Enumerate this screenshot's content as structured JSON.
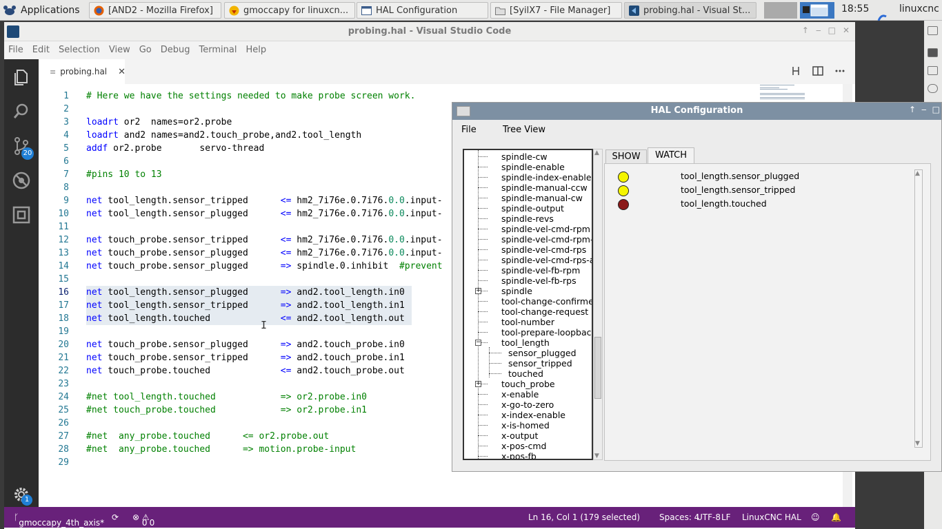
{
  "taskbar": {
    "applications": "Applications",
    "tasks": [
      {
        "label": "[AND2 - Mozilla Firefox]",
        "icon": "firefox-icon"
      },
      {
        "label": "gmoccapy for linuxcn...",
        "icon": "gmoccapy-icon"
      },
      {
        "label": "HAL Configuration",
        "icon": "window-icon"
      },
      {
        "label": "[SyilX7 - File Manager]",
        "icon": "folder-icon"
      },
      {
        "label": "probing.hal - Visual St...",
        "icon": "vscode-icon"
      }
    ],
    "clock": "18:55",
    "user": "linuxcnc"
  },
  "vscode": {
    "title": "probing.hal - Visual Studio Code",
    "menu": [
      "File",
      "Edit",
      "Selection",
      "View",
      "Go",
      "Debug",
      "Terminal",
      "Help"
    ],
    "tab": "probing.hal",
    "scm_badge": "20",
    "settings_badge": "1",
    "lines": [
      {
        "n": "1",
        "segs": [
          {
            "t": "# Here we have the settings needed to make probe screen work.",
            "c": "cm"
          }
        ]
      },
      {
        "n": "2",
        "segs": []
      },
      {
        "n": "3",
        "segs": [
          {
            "t": "loadrt",
            "c": "kw"
          },
          {
            "t": " or2  names=or2.probe",
            "c": ""
          }
        ]
      },
      {
        "n": "4",
        "segs": [
          {
            "t": "loadrt",
            "c": "kw"
          },
          {
            "t": " and2 names=and2.touch_probe,and2.tool_length",
            "c": ""
          }
        ]
      },
      {
        "n": "5",
        "segs": [
          {
            "t": "addf",
            "c": "kw"
          },
          {
            "t": " or2.probe       servo-thread",
            "c": ""
          }
        ]
      },
      {
        "n": "6",
        "segs": []
      },
      {
        "n": "7",
        "segs": [
          {
            "t": "#pins 10 to 13",
            "c": "cm"
          }
        ]
      },
      {
        "n": "8",
        "segs": []
      },
      {
        "n": "9",
        "segs": [
          {
            "t": "net",
            "c": "kw"
          },
          {
            "t": " tool_length.sensor_tripped      ",
            "c": ""
          },
          {
            "t": "<=",
            "c": "kw"
          },
          {
            "t": " hm2_7i76e.0.7i76.",
            "c": ""
          },
          {
            "t": "0.0",
            "c": "num"
          },
          {
            "t": ".input-",
            "c": ""
          }
        ]
      },
      {
        "n": "10",
        "segs": [
          {
            "t": "net",
            "c": "kw"
          },
          {
            "t": " tool_length.sensor_plugged      ",
            "c": ""
          },
          {
            "t": "<=",
            "c": "kw"
          },
          {
            "t": " hm2_7i76e.0.7i76.",
            "c": ""
          },
          {
            "t": "0.0",
            "c": "num"
          },
          {
            "t": ".input-",
            "c": ""
          }
        ]
      },
      {
        "n": "11",
        "segs": []
      },
      {
        "n": "12",
        "segs": [
          {
            "t": "net",
            "c": "kw"
          },
          {
            "t": " touch_probe.sensor_tripped      ",
            "c": ""
          },
          {
            "t": "<=",
            "c": "kw"
          },
          {
            "t": " hm2_7i76e.0.7i76.",
            "c": ""
          },
          {
            "t": "0.0",
            "c": "num"
          },
          {
            "t": ".input-",
            "c": ""
          }
        ]
      },
      {
        "n": "13",
        "segs": [
          {
            "t": "net",
            "c": "kw"
          },
          {
            "t": " touch_probe.sensor_plugged      ",
            "c": ""
          },
          {
            "t": "<=",
            "c": "kw"
          },
          {
            "t": " hm2_7i76e.0.7i76.",
            "c": ""
          },
          {
            "t": "0.0",
            "c": "num"
          },
          {
            "t": ".input-",
            "c": ""
          }
        ]
      },
      {
        "n": "14",
        "segs": [
          {
            "t": "net",
            "c": "kw"
          },
          {
            "t": " touch_probe.sensor_plugged      ",
            "c": ""
          },
          {
            "t": "=>",
            "c": "kw"
          },
          {
            "t": " spindle.0.inhibit  ",
            "c": ""
          },
          {
            "t": "#prevent",
            "c": "cm"
          }
        ]
      },
      {
        "n": "15",
        "segs": []
      },
      {
        "n": "16",
        "segs": [
          {
            "t": "net",
            "c": "kw"
          },
          {
            "t": " tool_length.sensor_plugged      ",
            "c": ""
          },
          {
            "t": "=>",
            "c": "kw"
          },
          {
            "t": " and2.tool_length.in0",
            "c": ""
          }
        ]
      },
      {
        "n": "17",
        "segs": [
          {
            "t": "net",
            "c": "kw"
          },
          {
            "t": " tool_length.sensor_tripped      ",
            "c": ""
          },
          {
            "t": "=>",
            "c": "kw"
          },
          {
            "t": " and2.tool_length.in1",
            "c": ""
          }
        ]
      },
      {
        "n": "18",
        "segs": [
          {
            "t": "net",
            "c": "kw"
          },
          {
            "t": " tool_length.touched             ",
            "c": ""
          },
          {
            "t": "<=",
            "c": "kw"
          },
          {
            "t": " and2.tool_length.out",
            "c": ""
          }
        ]
      },
      {
        "n": "19",
        "segs": []
      },
      {
        "n": "20",
        "segs": [
          {
            "t": "net",
            "c": "kw"
          },
          {
            "t": " touch_probe.sensor_plugged      ",
            "c": ""
          },
          {
            "t": "=>",
            "c": "kw"
          },
          {
            "t": " and2.touch_probe.in0",
            "c": ""
          }
        ]
      },
      {
        "n": "21",
        "segs": [
          {
            "t": "net",
            "c": "kw"
          },
          {
            "t": " touch_probe.sensor_tripped      ",
            "c": ""
          },
          {
            "t": "=>",
            "c": "kw"
          },
          {
            "t": " and2.touch_probe.in1",
            "c": ""
          }
        ]
      },
      {
        "n": "22",
        "segs": [
          {
            "t": "net",
            "c": "kw"
          },
          {
            "t": " touch_probe.touched             ",
            "c": ""
          },
          {
            "t": "<=",
            "c": "kw"
          },
          {
            "t": " and2.touch_probe.out",
            "c": ""
          }
        ]
      },
      {
        "n": "23",
        "segs": []
      },
      {
        "n": "24",
        "segs": [
          {
            "t": "#net tool_length.touched            => or2.probe.in0",
            "c": "cm"
          }
        ]
      },
      {
        "n": "25",
        "segs": [
          {
            "t": "#net touch_probe.touched            => or2.probe.in1",
            "c": "cm"
          }
        ]
      },
      {
        "n": "26",
        "segs": []
      },
      {
        "n": "27",
        "segs": [
          {
            "t": "#net  any_probe.touched      <= or2.probe.out",
            "c": "cm"
          }
        ]
      },
      {
        "n": "28",
        "segs": [
          {
            "t": "#net  any_probe.touched      => motion.probe-input",
            "c": "cm"
          }
        ]
      },
      {
        "n": "29",
        "segs": []
      }
    ],
    "status": {
      "branch": "gmoccapy_4th_axis*",
      "errors": "0",
      "warnings": "0",
      "position": "Ln 16, Col 1 (179 selected)",
      "spaces": "Spaces: 4",
      "encoding": "UTF-8",
      "eol": "LF",
      "language": "LinuxCNC HAL"
    }
  },
  "hal": {
    "title": "HAL Configuration",
    "menu": [
      "File",
      "Tree View"
    ],
    "tree": [
      {
        "label": "spindle-cw",
        "depth": 0
      },
      {
        "label": "spindle-enable",
        "depth": 0
      },
      {
        "label": "spindle-index-enable",
        "depth": 0
      },
      {
        "label": "spindle-manual-ccw",
        "depth": 0
      },
      {
        "label": "spindle-manual-cw",
        "depth": 0
      },
      {
        "label": "spindle-output",
        "depth": 0
      },
      {
        "label": "spindle-revs",
        "depth": 0
      },
      {
        "label": "spindle-vel-cmd-rpm",
        "depth": 0
      },
      {
        "label": "spindle-vel-cmd-rpm-a",
        "depth": 0
      },
      {
        "label": "spindle-vel-cmd-rps",
        "depth": 0
      },
      {
        "label": "spindle-vel-cmd-rps-al",
        "depth": 0
      },
      {
        "label": "spindle-vel-fb-rpm",
        "depth": 0
      },
      {
        "label": "spindle-vel-fb-rps",
        "depth": 0
      },
      {
        "label": "spindle",
        "depth": 0,
        "expander": "+"
      },
      {
        "label": "tool-change-confirmed",
        "depth": 0
      },
      {
        "label": "tool-change-request",
        "depth": 0
      },
      {
        "label": "tool-number",
        "depth": 0
      },
      {
        "label": "tool-prepare-loopback",
        "depth": 0
      },
      {
        "label": "tool_length",
        "depth": 0,
        "expander": "-"
      },
      {
        "label": "sensor_plugged",
        "depth": 1
      },
      {
        "label": "sensor_tripped",
        "depth": 1
      },
      {
        "label": "touched",
        "depth": 1
      },
      {
        "label": "touch_probe",
        "depth": 0,
        "expander": "+"
      },
      {
        "label": "x-enable",
        "depth": 0
      },
      {
        "label": "x-go-to-zero",
        "depth": 0
      },
      {
        "label": "x-index-enable",
        "depth": 0
      },
      {
        "label": "x-is-homed",
        "depth": 0
      },
      {
        "label": "x-output",
        "depth": 0
      },
      {
        "label": "x-pos-cmd",
        "depth": 0
      },
      {
        "label": "x-pos-fb",
        "depth": 0
      }
    ],
    "tabs": {
      "show": "SHOW",
      "watch": "WATCH"
    },
    "watch": [
      {
        "label": "tool_length.sensor_plugged",
        "color": "#f5f500"
      },
      {
        "label": "tool_length.sensor_tripped",
        "color": "#f5f500"
      },
      {
        "label": "tool_length.touched",
        "color": "#8b1a1a"
      }
    ]
  }
}
